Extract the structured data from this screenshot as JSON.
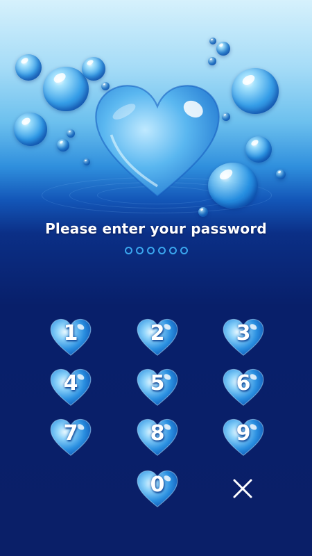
{
  "lock_screen": {
    "prompt": "Please enter your password",
    "pin_length": 6,
    "keypad": {
      "keys": [
        "1",
        "2",
        "3",
        "4",
        "5",
        "6",
        "7",
        "8",
        "9",
        "0"
      ],
      "delete_icon": "close-icon"
    },
    "theme": {
      "accent": "#3aa6ee",
      "background_top": "#a6dcf7",
      "background_bottom": "#0a1f68",
      "text": "#ffffff"
    }
  }
}
